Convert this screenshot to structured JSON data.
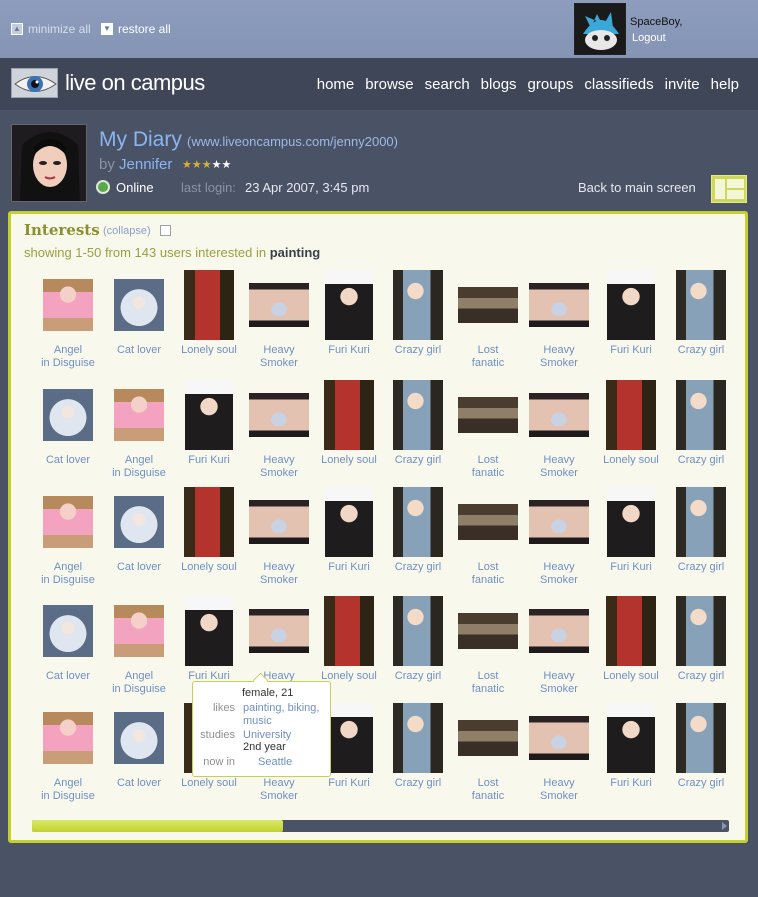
{
  "window_controls": {
    "minimize_all": "minimize all",
    "restore_all": "restore all"
  },
  "current_user": {
    "name": "SpaceBoy,",
    "logout": "Logout"
  },
  "site": {
    "name": "live on campus"
  },
  "nav": [
    "home",
    "browse",
    "search",
    "blogs",
    "groups",
    "classifieds",
    "invite",
    "help"
  ],
  "profile": {
    "title": "My Diary",
    "url": "(www.liveoncampus.com/jenny2000)",
    "by": "by",
    "name": "Jennifer",
    "stars_on": "★★★",
    "stars_off": "★★",
    "rating": 3,
    "rating_max": 5,
    "status": "Online",
    "last_login_label": "last login:",
    "last_login_value": "23 Apr 2007, 3:45 pm",
    "back_link": "Back to main screen"
  },
  "interests": {
    "title": "Interests",
    "collapse": "(collapse)",
    "showing_prefix": "showing 1-50 from 143 users interested in",
    "topic": "painting",
    "rows": [
      [
        {
          "label": "Angel\nin Disguise",
          "photo": "pink"
        },
        {
          "label": "Cat lover",
          "photo": "white"
        },
        {
          "label": "Lonely soul",
          "photo": "red"
        },
        {
          "label": "Heavy\nSmoker",
          "photo": "smoke"
        },
        {
          "label": "Furi Kuri",
          "photo": "furi"
        },
        {
          "label": "Crazy girl",
          "photo": "crazy"
        },
        {
          "label": "Lost\nfanatic",
          "photo": "lost"
        },
        {
          "label": "Heavy\nSmoker",
          "photo": "smoke"
        },
        {
          "label": "Furi Kuri",
          "photo": "furi"
        },
        {
          "label": "Crazy girl",
          "photo": "crazy"
        }
      ],
      [
        {
          "label": "Cat lover",
          "photo": "white"
        },
        {
          "label": "Angel\nin Disguise",
          "photo": "pink"
        },
        {
          "label": "Furi Kuri",
          "photo": "furi"
        },
        {
          "label": "Heavy\nSmoker",
          "photo": "smoke"
        },
        {
          "label": "Lonely soul",
          "photo": "red"
        },
        {
          "label": "Crazy girl",
          "photo": "crazy"
        },
        {
          "label": "Lost\nfanatic",
          "photo": "lost"
        },
        {
          "label": "Heavy\nSmoker",
          "photo": "smoke"
        },
        {
          "label": "Lonely soul",
          "photo": "red"
        },
        {
          "label": "Crazy girl",
          "photo": "crazy"
        }
      ],
      [
        {
          "label": "Angel\nin Disguise",
          "photo": "pink"
        },
        {
          "label": "Cat lover",
          "photo": "white"
        },
        {
          "label": "Lonely soul",
          "photo": "red"
        },
        {
          "label": "Heavy\nSmoker",
          "photo": "smoke"
        },
        {
          "label": "Furi Kuri",
          "photo": "furi"
        },
        {
          "label": "Crazy girl",
          "photo": "crazy"
        },
        {
          "label": "Lost\nfanatic",
          "photo": "lost"
        },
        {
          "label": "Heavy\nSmoker",
          "photo": "smoke"
        },
        {
          "label": "Furi Kuri",
          "photo": "furi"
        },
        {
          "label": "Crazy girl",
          "photo": "crazy"
        }
      ],
      [
        {
          "label": "Cat lover",
          "photo": "white"
        },
        {
          "label": "Angel\nin Disguise",
          "photo": "pink"
        },
        {
          "label": "Furi Kuri",
          "photo": "furi"
        },
        {
          "label": "Heavy\nSmoker",
          "photo": "smoke"
        },
        {
          "label": "Lonely soul",
          "photo": "red"
        },
        {
          "label": "Crazy girl",
          "photo": "crazy"
        },
        {
          "label": "Lost\nfanatic",
          "photo": "lost"
        },
        {
          "label": "Heavy\nSmoker",
          "photo": "smoke"
        },
        {
          "label": "Lonely soul",
          "photo": "red"
        },
        {
          "label": "Crazy girl",
          "photo": "crazy"
        }
      ],
      [
        {
          "label": "Angel\nin Disguise",
          "photo": "pink"
        },
        {
          "label": "Cat lover",
          "photo": "white"
        },
        {
          "label": "Lonely soul",
          "photo": "red"
        },
        {
          "label": "Heavy\nSmoker",
          "photo": "smoke"
        },
        {
          "label": "Furi Kuri",
          "photo": "furi"
        },
        {
          "label": "Crazy girl",
          "photo": "crazy"
        },
        {
          "label": "Lost\nfanatic",
          "photo": "lost"
        },
        {
          "label": "Heavy\nSmoker",
          "photo": "smoke"
        },
        {
          "label": "Furi Kuri",
          "photo": "furi"
        },
        {
          "label": "Crazy girl",
          "photo": "crazy"
        }
      ]
    ]
  },
  "tooltip": {
    "summary": "female, 21",
    "likes_label": "likes",
    "likes_value": "painting, biking,\nmusic",
    "studies_label": "studies",
    "studies_value": "University",
    "studies_year": "2nd year",
    "now_in_label": "now in",
    "now_in_value": "Seattle"
  },
  "scroll": {
    "position": 0.36
  },
  "colors": {
    "accent": "#c4d032",
    "link": "#6f8fc4",
    "background": "#4a5266",
    "panel": "#f8f9ec"
  }
}
